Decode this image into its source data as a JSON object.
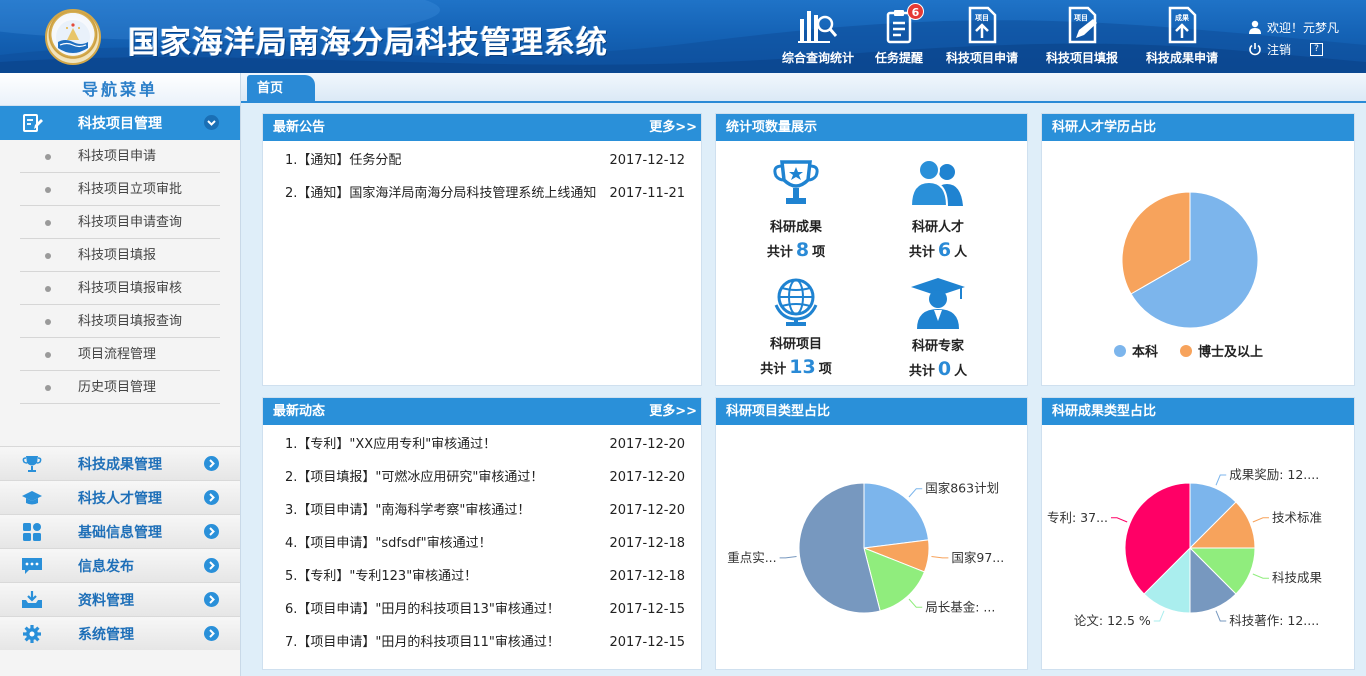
{
  "header": {
    "title": "国家海洋局南海分局科技管理系统",
    "buttons": [
      {
        "label": "综合查询统计",
        "icon": "bar-chart-icon"
      },
      {
        "label": "任务提醒",
        "icon": "clipboard-icon",
        "badge": "6"
      },
      {
        "label": "科技项目申请",
        "icon": "doc-upload-icon",
        "doc_text": "项目"
      },
      {
        "label": "科技项目填报",
        "icon": "doc-edit-icon",
        "doc_text": "项目"
      },
      {
        "label": "科技成果申请",
        "icon": "doc-upload-icon",
        "doc_text": "成果"
      }
    ],
    "user": {
      "welcome": "欢迎！元梦凡",
      "logout": "注销",
      "help": "?"
    }
  },
  "sidebar": {
    "title": "导航菜单",
    "active_group": "科技项目管理",
    "sub_items": [
      "科技项目申请",
      "科技项目立项审批",
      "科技项目申请查询",
      "科技项目填报",
      "科技项目填报审核",
      "科技项目填报查询",
      "项目流程管理",
      "历史项目管理"
    ],
    "groups": [
      "科技成果管理",
      "科技人才管理",
      "基础信息管理",
      "信息发布",
      "资料管理",
      "系统管理"
    ]
  },
  "tabs": {
    "home": "首页"
  },
  "notice": {
    "title": "最新公告",
    "more": "更多>>",
    "items": [
      {
        "text": "1.【通知】任务分配",
        "date": "2017-12-12"
      },
      {
        "text": "2.【通知】国家海洋局南海分局科技管理系统上线通知",
        "date": "2017-11-21"
      }
    ]
  },
  "activity": {
    "title": "最新动态",
    "more": "更多>>",
    "items": [
      {
        "text": "1.【专利】\"XX应用专利\"审核通过！",
        "date": "2017-12-20"
      },
      {
        "text": "2.【项目填报】\"可燃冰应用研究\"审核通过！",
        "date": "2017-12-20"
      },
      {
        "text": "3.【项目申请】\"南海科学考察\"审核通过！",
        "date": "2017-12-20"
      },
      {
        "text": "4.【项目申请】\"sdfsdf\"审核通过！",
        "date": "2017-12-18"
      },
      {
        "text": "5.【专利】\"专利123\"审核通过！",
        "date": "2017-12-18"
      },
      {
        "text": "6.【项目申请】\"田月的科技项目13\"审核通过！",
        "date": "2017-12-15"
      },
      {
        "text": "7.【项目申请】\"田月的科技项目11\"审核通过！",
        "date": "2017-12-15"
      }
    ]
  },
  "stats": {
    "title": "统计项数量展示",
    "items": [
      {
        "name": "科研成果",
        "prefix": "共计",
        "count": "8",
        "unit": "项",
        "icon": "trophy-icon"
      },
      {
        "name": "科研人才",
        "prefix": "共计",
        "count": "6",
        "unit": "人",
        "icon": "people-icon"
      },
      {
        "name": "科研项目",
        "prefix": "共计",
        "count": "13",
        "unit": "项",
        "icon": "globe-icon"
      },
      {
        "name": "科研专家",
        "prefix": "共计",
        "count": "0",
        "unit": "人",
        "icon": "graduate-icon"
      }
    ]
  },
  "chart_titles": {
    "edu": "科研人才学历占比",
    "proj": "科研项目类型占比",
    "result": "科研成果类型占比"
  },
  "chart_data": [
    {
      "type": "pie",
      "categories": [
        "本科",
        "博士及以上"
      ],
      "values": [
        66.7,
        33.3
      ],
      "colors": [
        "#7cb5ec",
        "#f7a35c"
      ],
      "legend": "bottom"
    },
    {
      "type": "pie",
      "categories": [
        "国家863计划",
        "国家97...",
        "局长基金: ...",
        "重点实..."
      ],
      "values": [
        23,
        8,
        15,
        54
      ],
      "colors": [
        "#7cb5ec",
        "#f7a35c",
        "#90ed7d",
        "#7798bf"
      ]
    },
    {
      "type": "pie",
      "categories": [
        "成果奖励: 12....",
        "技术标准",
        "科技成果",
        "科技著作: 12....",
        "论文: 12.5 %",
        "专利: 37..."
      ],
      "values": [
        12.5,
        12.5,
        12.5,
        12.5,
        12.5,
        37.5
      ],
      "colors": [
        "#7cb5ec",
        "#f7a35c",
        "#90ed7d",
        "#7798bf",
        "#aaeeee",
        "#ff0066"
      ]
    }
  ]
}
